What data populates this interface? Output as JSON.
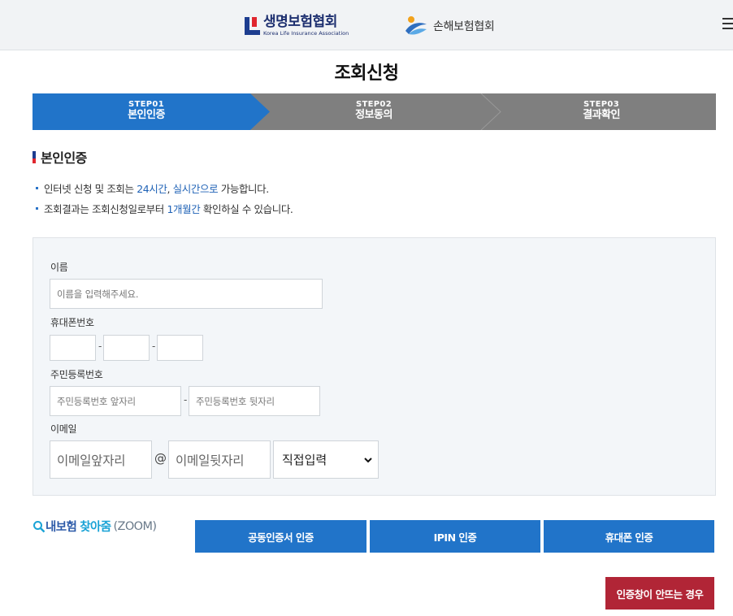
{
  "header": {
    "life_logo_ko": "생명보험협회",
    "life_logo_en": "Korea Life Insurance Association",
    "nonlife_logo_ko": "손해보험협회",
    "brand_blue": "#1d3d8f",
    "brand_red": "#e0262e"
  },
  "page": {
    "title": "조회신청"
  },
  "steps": [
    {
      "num": "STEP01",
      "name": "본인인증",
      "active": true
    },
    {
      "num": "STEP02",
      "name": "정보동의",
      "active": false
    },
    {
      "num": "STEP03",
      "name": "결과확인",
      "active": false
    }
  ],
  "colors": {
    "active_step": "#2174c9",
    "inactive_step": "#7f7f7f",
    "button": "#2174c9",
    "fail_button": "#b12536"
  },
  "section": {
    "title": "본인인증"
  },
  "notes": [
    {
      "pre": "인터넷 신청 및 조회는 ",
      "hl1": "24시간",
      "mid": ", ",
      "hl2": "실시간으로",
      "post": " 가능합니다."
    },
    {
      "pre": "조회결과는 조회신청일로부터 ",
      "hl1": "1개월간",
      "post": " 확인하실 수 있습니다."
    }
  ],
  "form": {
    "name_label": "이름",
    "name_placeholder": "이름을 입력해주세요.",
    "phone_label": "휴대폰번호",
    "phone_sep": "-",
    "rrn_label": "주민등록번호",
    "rrn_front_placeholder": "주민등록번호 앞자리",
    "rrn_back_placeholder": "주민등록번호 뒷자리",
    "rrn_sep": "-",
    "email_label": "이메일",
    "email_local_placeholder": "이메일앞자리",
    "email_at": "@",
    "email_domain_placeholder": "이메일뒷자리",
    "email_select_value": "직접입력"
  },
  "zoom": {
    "a": "내보험",
    "b": "찾아줌",
    "c": "(ZOOM)"
  },
  "buttons": {
    "cert": "공동인증서 인증",
    "ipin": "IPIN 인증",
    "phone": "휴대폰 인증",
    "fail": "인증창이 안뜨는 경우"
  }
}
